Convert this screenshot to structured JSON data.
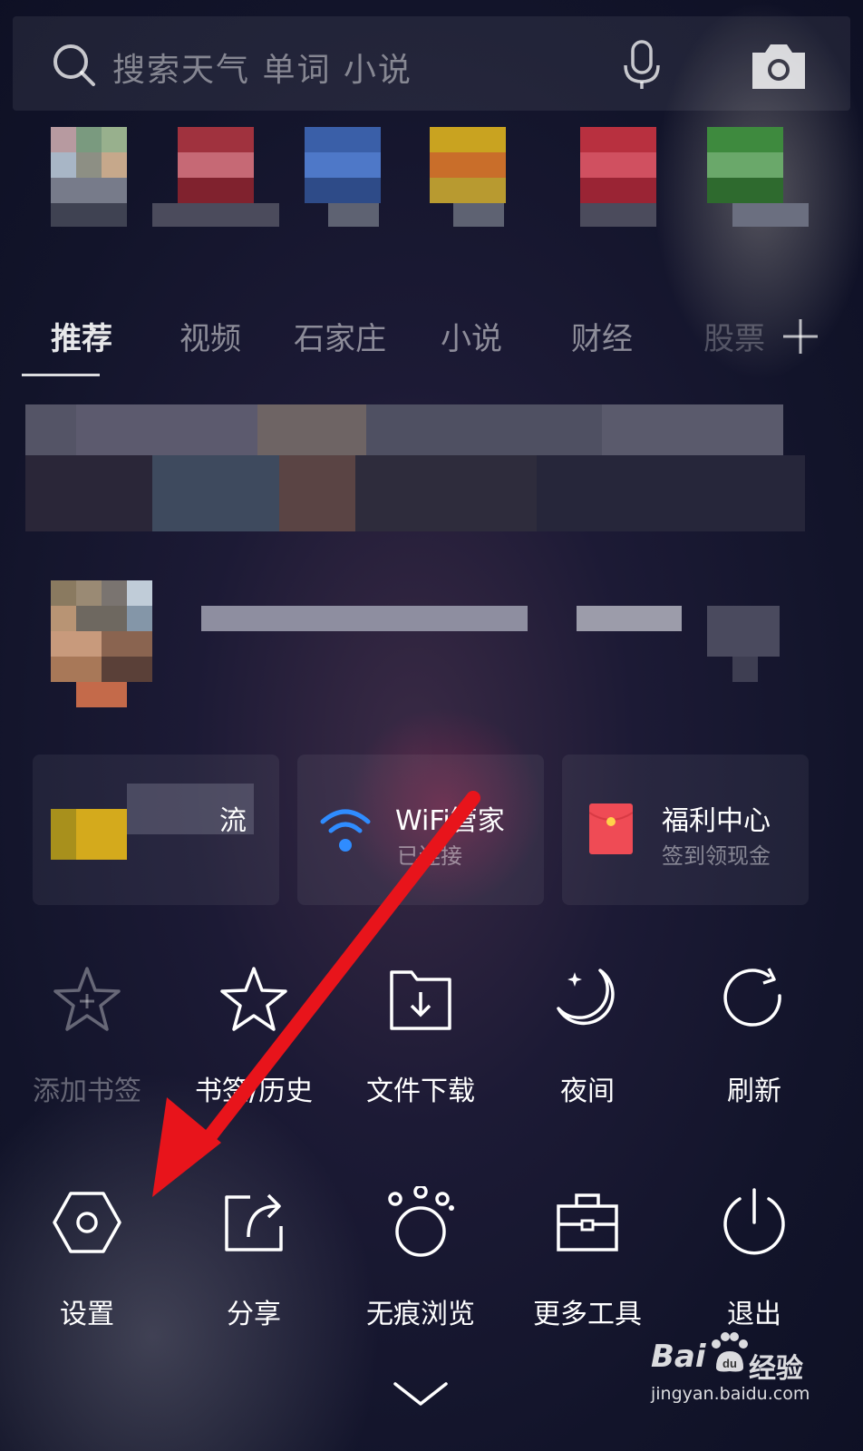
{
  "search": {
    "placeholder": "搜索天气 单词 小说"
  },
  "tabs": [
    {
      "label": "推荐",
      "active": true
    },
    {
      "label": "视频"
    },
    {
      "label": "石家庄"
    },
    {
      "label": "小说"
    },
    {
      "label": "财经"
    },
    {
      "label": "股票"
    }
  ],
  "quick_cards": [
    {
      "title": "流",
      "subtitle": ""
    },
    {
      "title": "WiFi管家",
      "subtitle": "已连接"
    },
    {
      "title": "福利中心",
      "subtitle": "签到领现金"
    }
  ],
  "menu": {
    "row1": [
      {
        "label": "添加书签",
        "icon": "star-plus-icon",
        "enabled": false
      },
      {
        "label": "书签/历史",
        "icon": "star-icon",
        "enabled": true
      },
      {
        "label": "文件下载",
        "icon": "folder-download-icon",
        "enabled": true
      },
      {
        "label": "夜间",
        "icon": "moon-icon",
        "enabled": true
      },
      {
        "label": "刷新",
        "icon": "refresh-icon",
        "enabled": true
      }
    ],
    "row2": [
      {
        "label": "设置",
        "icon": "hexagon-settings-icon",
        "enabled": true
      },
      {
        "label": "分享",
        "icon": "share-icon",
        "enabled": true
      },
      {
        "label": "无痕浏览",
        "icon": "paw-icon",
        "enabled": true
      },
      {
        "label": "更多工具",
        "icon": "toolbox-icon",
        "enabled": true
      },
      {
        "label": "退出",
        "icon": "power-icon",
        "enabled": true
      }
    ]
  },
  "watermark": {
    "brand": "Bai",
    "brand_cn": "经验",
    "url": "jingyan.baidu.com"
  },
  "colors": {
    "wifi_blue": "#2f8cff",
    "arrow_red": "#e8141b",
    "red_packet": "#ef4b55"
  }
}
